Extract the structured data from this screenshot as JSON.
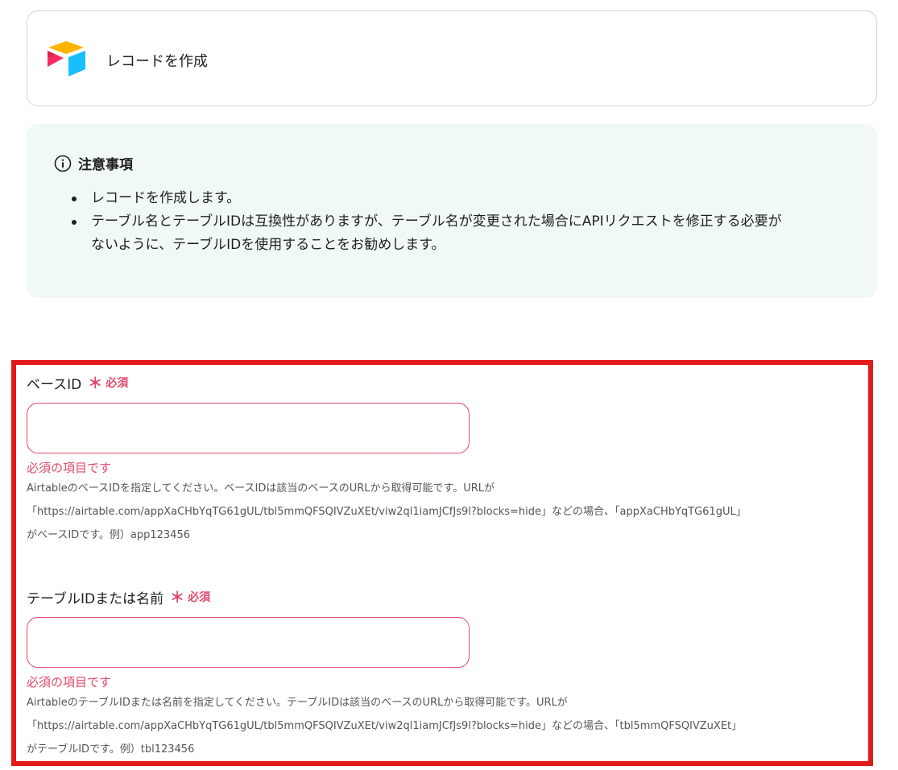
{
  "action": {
    "title": "レコードを作成",
    "icon": "airtable-logo-icon"
  },
  "notice": {
    "title": "注意事項",
    "items": [
      "レコードを作成します。",
      "テーブル名とテーブルIDは互換性がありますが、テーブル名が変更された場合にAPIリクエストを修正する必要が",
      "ないように、テーブルIDを使用することをお勧めします。"
    ]
  },
  "fields": {
    "base_id": {
      "label": "ベースID",
      "required_mark": "＊",
      "required_text": "必須",
      "value": "",
      "error": "必須の項目です",
      "help": [
        "AirtableのベースIDを指定してください。ベースIDは該当のベースのURLから取得可能です。URLが",
        "「https://airtable.com/appXaCHbYqTG61gUL/tbl5mmQFSQIVZuXEt/viw2ql1iamJCfJs9l?blocks=hide」などの場合、「appXaCHbYqTG61gUL」",
        "がベースIDです。例）app123456"
      ]
    },
    "table_id": {
      "label": "テーブルIDまたは名前",
      "required_mark": "＊",
      "required_text": "必須",
      "value": "",
      "error": "必須の項目です",
      "help": [
        "AirtableのテーブルIDまたは名前を指定してください。テーブルIDは該当のベースのURLから取得可能です。URLが",
        "「https://airtable.com/appXaCHbYqTG61gUL/tbl5mmQFSQIVZuXEt/viw2ql1iamJCfJs9l?blocks=hide」などの場合、「tbl5mmQFSQIVZuXEt」",
        "がテーブルIDです。例）tbl123456"
      ]
    }
  },
  "colors": {
    "required": "#e04a6a",
    "highlight": "#e11a1a",
    "notice_bg": "#f1f8f8"
  }
}
